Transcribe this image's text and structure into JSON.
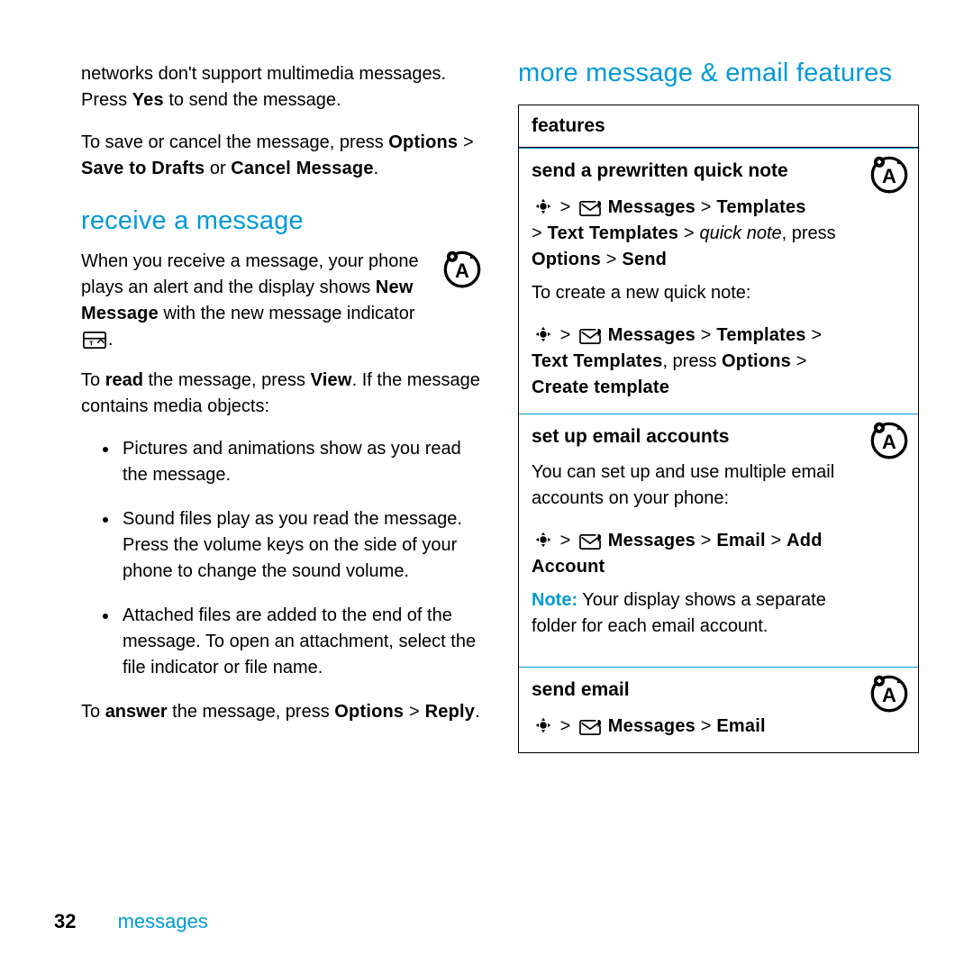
{
  "left": {
    "p1a": "networks don't support multimedia messages. Press ",
    "p1b": "Yes",
    "p1c": " to send the message.",
    "p2a": "To save or cancel the message, press ",
    "p2b": "Options",
    "p2_gt": " > ",
    "p2c": "Save to Drafts",
    "p2d": " or ",
    "p2e": "Cancel Message",
    "p2f": ".",
    "h_receive": "receive a message",
    "p3a": "When you receive a message, your phone plays an alert and the display shows ",
    "p3b": "New Message",
    "p3c": " with the new message indicator",
    "p3d": ".",
    "p4a": "To ",
    "p4b": "read",
    "p4c": " the message, press ",
    "p4d": "View",
    "p4e": ". If the message contains media objects:",
    "li1": "Pictures and animations show as you read the message.",
    "li2": "Sound files play as you read the message. Press the volume keys on the side of your phone to change the sound volume.",
    "li3": "Attached files are added to the end of the message. To open an attachment, select the file indicator or file name.",
    "p5a": "To ",
    "p5b": "answer",
    "p5c": " the message, press ",
    "p5d": "Options",
    "p5_gt": " > ",
    "p5e": "Reply",
    "p5f": "."
  },
  "right": {
    "h_more": "more message & email features",
    "tbl_hdr": "features",
    "row1": {
      "title": "send a prewritten quick note",
      "nav_msgs": "Messages",
      "nav_tpl": "Templates",
      "nav_txttpl": "Text Templates",
      "quick": "quick note",
      "press": ", press ",
      "opt": "Options",
      "send": "Send",
      "create_txt": "To create a new quick note:",
      "ctpl": "Create template"
    },
    "row2": {
      "title": "set up email accounts",
      "txt": "You can set up and use multiple email accounts on your phone:",
      "msgs": "Messages",
      "email": "Email",
      "add": "Add Account",
      "note_lbl": "Note:",
      "note_txt": " Your display shows a separate folder for each email account."
    },
    "row3": {
      "title": "send email",
      "msgs": "Messages",
      "email": "Email"
    }
  },
  "footer": {
    "num": "32",
    "section": "messages"
  },
  "glyphs": {
    "gt": " > "
  }
}
